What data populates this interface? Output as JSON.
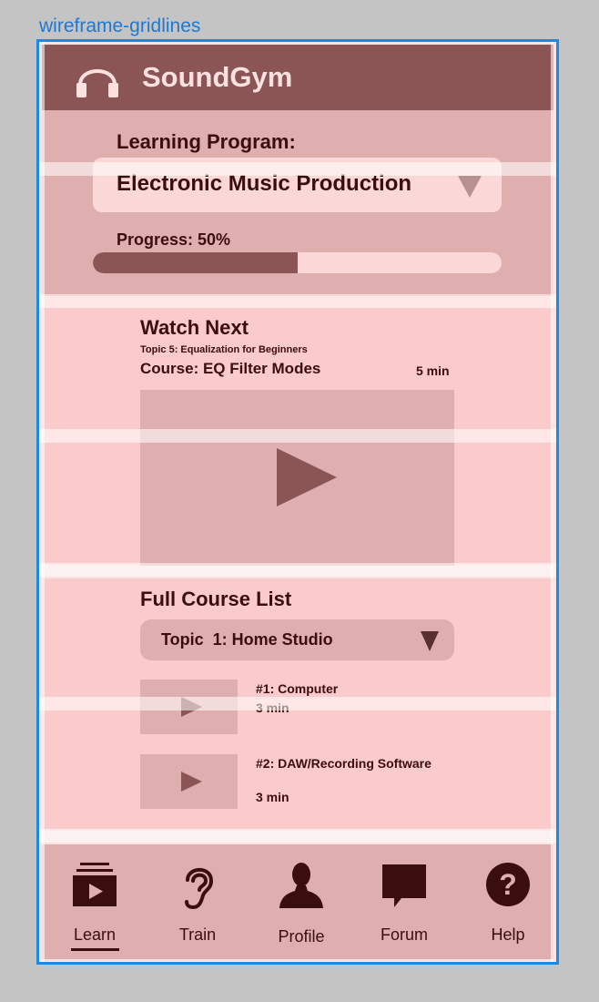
{
  "frame": {
    "label": "wireframe-gridlines"
  },
  "header": {
    "app_title": "SoundGym",
    "logo_icon": "headphones-icon"
  },
  "program": {
    "label": "Learning Program:",
    "selected": "Electronic Music Production",
    "progress_label": "Progress: 50%",
    "progress_fraction": 0.5
  },
  "watch_next": {
    "title": "Watch Next",
    "topic": "Topic 5: Equalization for Beginners",
    "course": "Course: EQ Filter Modes",
    "duration": "5 min"
  },
  "course_list": {
    "title": "Full Course List",
    "topic_selected": "Topic  1: Home Studio",
    "items": [
      {
        "name": "#1: Computer",
        "duration": "3 min"
      },
      {
        "name": "#2: DAW/Recording Software",
        "duration": "3 min"
      }
    ]
  },
  "nav": {
    "active": "Learn",
    "items": [
      {
        "label": "Learn",
        "icon": "video-library-icon"
      },
      {
        "label": "Train",
        "icon": "ear-icon"
      },
      {
        "label": "Profile",
        "icon": "person-icon"
      },
      {
        "label": "Forum",
        "icon": "chat-bubble-icon"
      },
      {
        "label": "Help",
        "icon": "help-icon"
      }
    ]
  },
  "colors": {
    "header_bg": "#8b5556",
    "panel_light": "#fbcaca",
    "panel_mid": "#dfafaf",
    "text_dark": "#3a0d0f",
    "frame_border": "#1e88e5"
  }
}
